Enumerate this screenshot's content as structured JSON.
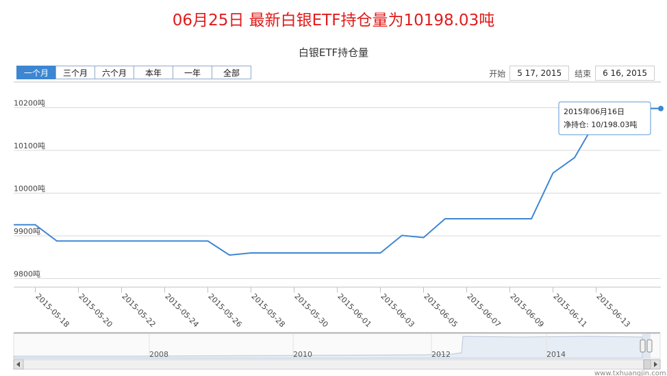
{
  "headline": "06月25日 最新白银ETF持仓量为10198.03吨",
  "range_selector": {
    "buttons": [
      "一个月",
      "三个月",
      "六个月",
      "本年",
      "一年",
      "全部"
    ],
    "active_index": 0,
    "start_label": "开始",
    "start_value": "5 17, 2015",
    "end_label": "结束",
    "end_value": "6 16, 2015"
  },
  "tooltip": {
    "date": "2015年06月16日",
    "value": "净持仓: 10/198.03吨"
  },
  "watermark": "www.txhuangjin.com",
  "navigator": {
    "year_labels": [
      "2008",
      "2010",
      "2012",
      "2014"
    ]
  },
  "colors": {
    "line": "#3d86d1",
    "headline": "#e01b1b",
    "grid": "#d8d8d8",
    "active_button": "#3d86d1"
  },
  "chart_data": {
    "type": "line",
    "title": "白银ETF持仓量",
    "ylim": [
      9780,
      10260
    ],
    "yticks": [
      9800,
      9900,
      10000,
      10100,
      10200
    ],
    "ytick_labels": [
      "9800吨",
      "9900吨",
      "10000吨",
      "10100吨",
      "10200吨"
    ],
    "xlim": [
      "2015-05-17",
      "2015-06-16"
    ],
    "xtick_labels": [
      "2015-05-18",
      "2015-05-20",
      "2015-05-22",
      "2015-05-24",
      "2015-05-26",
      "2015-05-28",
      "2015-05-30",
      "2015-06-01",
      "2015-06-03",
      "2015-06-05",
      "2015-06-07",
      "2015-06-09",
      "2015-06-11",
      "2015-06-13"
    ],
    "x": [
      "2015-05-17",
      "2015-05-18",
      "2015-05-19",
      "2015-05-20",
      "2015-05-21",
      "2015-05-22",
      "2015-05-23",
      "2015-05-24",
      "2015-05-25",
      "2015-05-26",
      "2015-05-27",
      "2015-05-28",
      "2015-05-29",
      "2015-05-30",
      "2015-05-31",
      "2015-06-01",
      "2015-06-02",
      "2015-06-03",
      "2015-06-04",
      "2015-06-05",
      "2015-06-06",
      "2015-06-07",
      "2015-06-08",
      "2015-06-09",
      "2015-06-10",
      "2015-06-11",
      "2015-06-12",
      "2015-06-13",
      "2015-06-14",
      "2015-06-15",
      "2015-06-16"
    ],
    "y": [
      9926,
      9926,
      9888,
      9888,
      9888,
      9888,
      9888,
      9888,
      9888,
      9888,
      9855,
      9860,
      9860,
      9860,
      9860,
      9860,
      9860,
      9860,
      9901,
      9896,
      9940,
      9940,
      9940,
      9940,
      9940,
      10047,
      10083,
      10170,
      10198,
      10198,
      10198
    ]
  }
}
